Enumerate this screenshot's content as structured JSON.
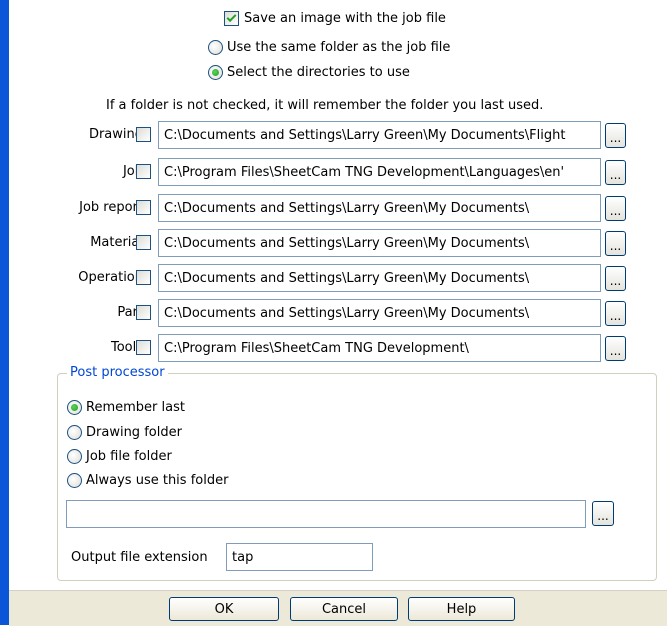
{
  "save_image": {
    "label": "Save an image with the job file",
    "checked": true
  },
  "folder_mode": {
    "options": [
      {
        "label": "Use the same folder as the job file",
        "selected": false
      },
      {
        "label": "Select the directories to use",
        "selected": true
      }
    ]
  },
  "hint": "If a folder is not checked, it will remember the folder you last used.",
  "directories": [
    {
      "label": "Drawing",
      "path": "C:\\Documents and Settings\\Larry Green\\My Documents\\Flight",
      "checked": false
    },
    {
      "label": "Job",
      "path": "C:\\Program Files\\SheetCam TNG Development\\Languages\\en'",
      "checked": false
    },
    {
      "label": "Job report",
      "path": "C:\\Documents and Settings\\Larry Green\\My Documents\\",
      "checked": false
    },
    {
      "label": "Material",
      "path": "C:\\Documents and Settings\\Larry Green\\My Documents\\",
      "checked": false
    },
    {
      "label": "Operation",
      "path": "C:\\Documents and Settings\\Larry Green\\My Documents\\",
      "checked": false
    },
    {
      "label": "Part",
      "path": "C:\\Documents and Settings\\Larry Green\\My Documents\\",
      "checked": false
    },
    {
      "label": "Tools",
      "path": "C:\\Program Files\\SheetCam TNG Development\\",
      "checked": false
    }
  ],
  "browse_label": "...",
  "post_processor": {
    "title": "Post processor",
    "options": [
      {
        "label": "Remember last",
        "selected": true
      },
      {
        "label": "Drawing folder",
        "selected": false
      },
      {
        "label": "Job file folder",
        "selected": false
      },
      {
        "label": "Always use this folder",
        "selected": false
      }
    ],
    "folder_value": "",
    "extension_label": "Output file extension",
    "extension_value": "tap"
  },
  "buttons": {
    "ok": "OK",
    "cancel": "Cancel",
    "help": "Help"
  }
}
